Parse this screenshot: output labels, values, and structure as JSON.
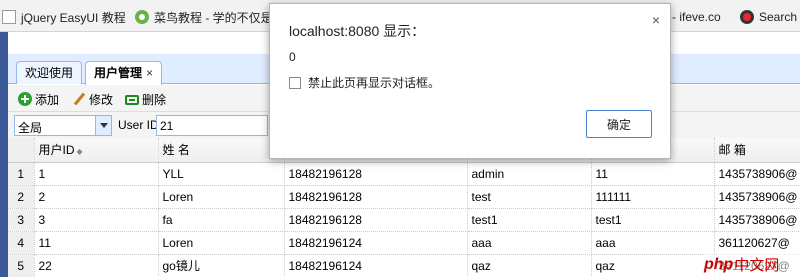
{
  "bookmarks": [
    {
      "label": "jQuery EasyUI 教程",
      "icon": "page-icon"
    },
    {
      "label": "菜鸟教程 - 学的不仅是",
      "icon": "runoob-icon"
    },
    {
      "label": "- ifeve.co",
      "icon": "page-icon"
    },
    {
      "label": "Search |",
      "icon": "search-icon"
    }
  ],
  "tabs": [
    {
      "label": "欢迎使用"
    },
    {
      "label": "用户管理",
      "close": "×"
    }
  ],
  "toolbar": {
    "add_label": "添加",
    "edit_label": "修改",
    "delete_label": "删除"
  },
  "search": {
    "scope_value": "全局",
    "userid_label": "User ID:",
    "userid_value": "21"
  },
  "grid": {
    "columns": [
      "用户ID",
      "姓 名",
      "",
      "",
      "",
      "邮 箱"
    ],
    "rows": [
      {
        "rn": "1",
        "id": "1",
        "name": "YLL",
        "phone": "18482196128",
        "user": "admin",
        "pwd": "11",
        "email": "1435738906@"
      },
      {
        "rn": "2",
        "id": "2",
        "name": "Loren",
        "phone": "18482196128",
        "user": "test",
        "pwd": "111111",
        "email": "1435738906@"
      },
      {
        "rn": "3",
        "id": "3",
        "name": "fa",
        "phone": "18482196128",
        "user": "test1",
        "pwd": "test1",
        "email": "1435738906@"
      },
      {
        "rn": "4",
        "id": "11",
        "name": "Loren",
        "phone": "18482196124",
        "user": "aaa",
        "pwd": "aaa",
        "email": "361120627@"
      },
      {
        "rn": "5",
        "id": "22",
        "name": "go镜儿",
        "phone": "18482196124",
        "user": "qaz",
        "pwd": "qaz",
        "email": "361120627@"
      }
    ]
  },
  "dialog": {
    "title": "localhost:8080 显示：",
    "close": "×",
    "message": "0",
    "checkbox_label": "禁止此页再显示对话框。",
    "ok_label": "确定"
  },
  "watermark": {
    "php": "php",
    "cn": "中文网"
  },
  "colors": {
    "tab_bg": "#e0ecff",
    "tab_border": "#95b8e7",
    "accent": "#4a7fd4"
  }
}
